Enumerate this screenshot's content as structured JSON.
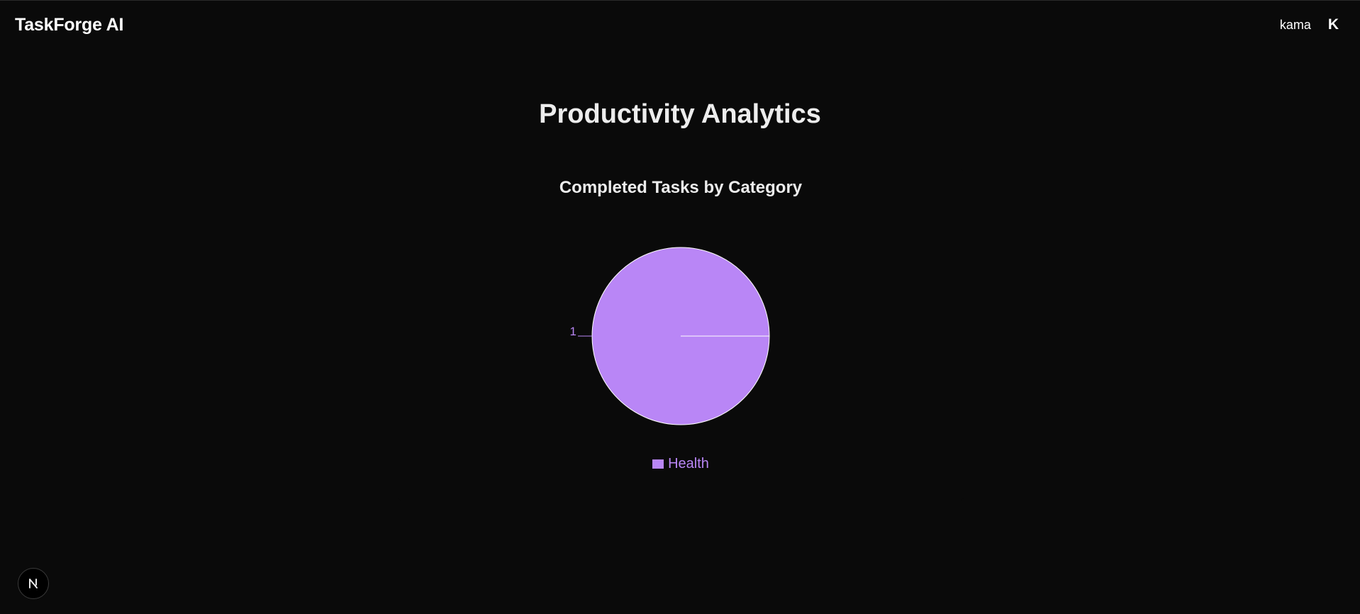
{
  "header": {
    "app_title": "TaskForge AI",
    "user_name": "kama",
    "avatar_initial": "K"
  },
  "main": {
    "page_title": "Productivity Analytics"
  },
  "chart_data": {
    "type": "pie",
    "title": "Completed Tasks by Category",
    "slices": [
      {
        "label": "Health",
        "value": 1,
        "color": "#b986f6"
      }
    ],
    "data_labels": [
      "1"
    ],
    "legend_placement": "bottom"
  },
  "colors": {
    "background": "#0a0a0a",
    "text": "#ededed",
    "slice_stroke": "#ffffff"
  },
  "badge": {
    "icon": "nextjs-icon"
  }
}
